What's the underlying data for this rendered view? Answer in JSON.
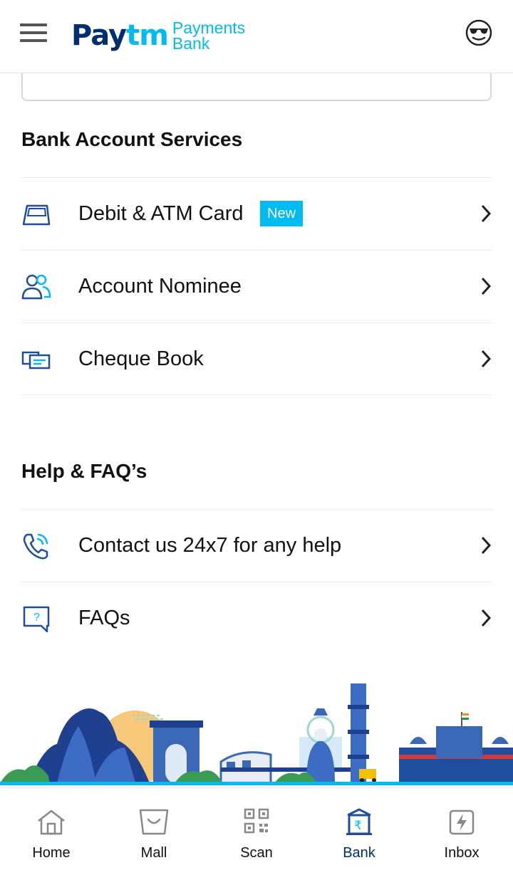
{
  "header": {
    "logo_main_pay": "Pay",
    "logo_main_tm": "tm",
    "logo_sub_line1": "Payments",
    "logo_sub_line2": "Bank"
  },
  "bank_services": {
    "title": "Bank Account Services",
    "items": [
      {
        "label": "Debit & ATM Card",
        "badge": "New",
        "icon": "card-icon"
      },
      {
        "label": "Account Nominee",
        "icon": "nominee-icon"
      },
      {
        "label": "Cheque Book",
        "icon": "cheque-icon"
      }
    ]
  },
  "help": {
    "title": "Help & FAQ’s",
    "items": [
      {
        "label": "Contact us 24x7 for any help",
        "icon": "phone-icon"
      },
      {
        "label": "FAQs",
        "icon": "faq-icon"
      }
    ]
  },
  "bottom_nav": {
    "items": [
      {
        "label": "Home",
        "icon": "home-icon"
      },
      {
        "label": "Mall",
        "icon": "mall-icon"
      },
      {
        "label": "Scan",
        "icon": "qr-scan-icon"
      },
      {
        "label": "Bank",
        "icon": "bank-icon",
        "active": true
      },
      {
        "label": "Inbox",
        "icon": "inbox-icon"
      }
    ]
  },
  "colors": {
    "brand_dark": "#002e6e",
    "brand_light": "#00baf2",
    "icon_blue": "#1f4e9e"
  }
}
